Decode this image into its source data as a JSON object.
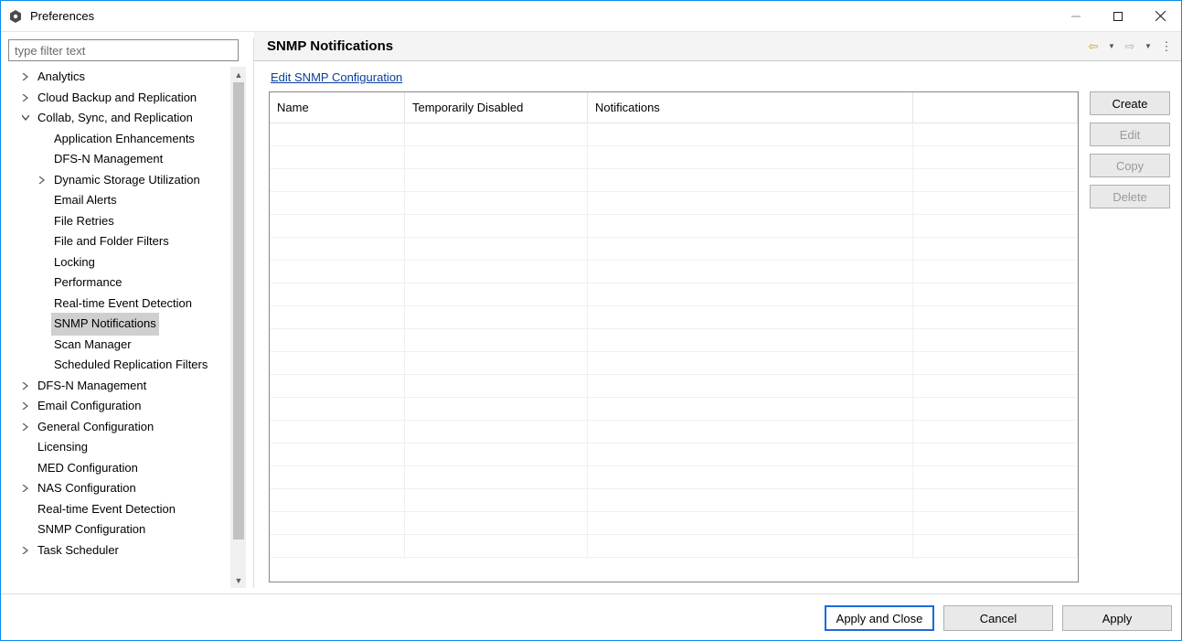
{
  "window": {
    "title": "Preferences"
  },
  "filter": {
    "placeholder": "type filter text"
  },
  "tree": [
    {
      "label": "Analytics",
      "indent": 0,
      "twisty": ">",
      "selected": false
    },
    {
      "label": "Cloud Backup and Replication",
      "indent": 0,
      "twisty": ">",
      "selected": false
    },
    {
      "label": "Collab, Sync, and Replication",
      "indent": 0,
      "twisty": "v",
      "selected": false
    },
    {
      "label": "Application Enhancements",
      "indent": 1,
      "twisty": "",
      "selected": false
    },
    {
      "label": "DFS-N Management",
      "indent": 1,
      "twisty": "",
      "selected": false
    },
    {
      "label": "Dynamic Storage Utilization",
      "indent": 1,
      "twisty": ">",
      "selected": false
    },
    {
      "label": "Email Alerts",
      "indent": 1,
      "twisty": "",
      "selected": false
    },
    {
      "label": "File Retries",
      "indent": 1,
      "twisty": "",
      "selected": false
    },
    {
      "label": "File and Folder Filters",
      "indent": 1,
      "twisty": "",
      "selected": false
    },
    {
      "label": "Locking",
      "indent": 1,
      "twisty": "",
      "selected": false
    },
    {
      "label": "Performance",
      "indent": 1,
      "twisty": "",
      "selected": false
    },
    {
      "label": "Real-time Event Detection",
      "indent": 1,
      "twisty": "",
      "selected": false
    },
    {
      "label": "SNMP Notifications",
      "indent": 1,
      "twisty": "",
      "selected": true
    },
    {
      "label": "Scan Manager",
      "indent": 1,
      "twisty": "",
      "selected": false
    },
    {
      "label": "Scheduled Replication Filters",
      "indent": 1,
      "twisty": "",
      "selected": false
    },
    {
      "label": "DFS-N Management",
      "indent": 0,
      "twisty": ">",
      "selected": false
    },
    {
      "label": "Email Configuration",
      "indent": 0,
      "twisty": ">",
      "selected": false
    },
    {
      "label": "General Configuration",
      "indent": 0,
      "twisty": ">",
      "selected": false
    },
    {
      "label": "Licensing",
      "indent": 0,
      "twisty": "",
      "selected": false
    },
    {
      "label": "MED Configuration",
      "indent": 0,
      "twisty": "",
      "selected": false
    },
    {
      "label": "NAS Configuration",
      "indent": 0,
      "twisty": ">",
      "selected": false
    },
    {
      "label": "Real-time Event Detection",
      "indent": 0,
      "twisty": "",
      "selected": false
    },
    {
      "label": "SNMP Configuration",
      "indent": 0,
      "twisty": "",
      "selected": false
    },
    {
      "label": "Task Scheduler",
      "indent": 0,
      "twisty": ">",
      "selected": false
    }
  ],
  "page": {
    "title": "SNMP Notifications",
    "edit_link": "Edit SNMP Configuration",
    "columns": {
      "name": "Name",
      "temp": "Temporarily Disabled",
      "notif": "Notifications"
    },
    "row_count": 19
  },
  "side_buttons": {
    "create": "Create",
    "edit": "Edit",
    "copy": "Copy",
    "delete": "Delete"
  },
  "footer": {
    "apply_close": "Apply and Close",
    "cancel": "Cancel",
    "apply": "Apply"
  }
}
